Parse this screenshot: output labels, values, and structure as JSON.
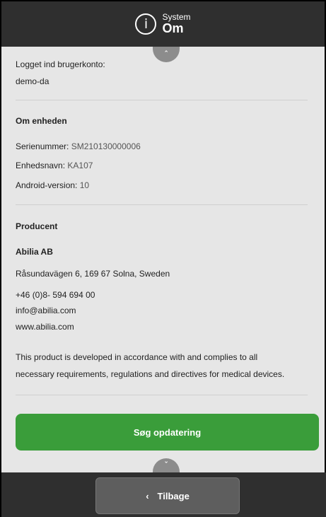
{
  "header": {
    "sup": "System",
    "title": "Om"
  },
  "account": {
    "label": "Logget ind brugerkonto:",
    "value": "demo-da"
  },
  "device": {
    "heading": "Om enheden",
    "serial_label": "Serienummer:",
    "serial_value": "SM210130000006",
    "name_label": "Enhedsnavn:",
    "name_value": "KA107",
    "android_label": "Android-version:",
    "android_value": "10"
  },
  "producer": {
    "heading": "Producent",
    "company": "Abilia AB",
    "address": "Råsundavägen 6, 169 67 Solna, Sweden",
    "phone": "+46 (0)8- 594 694 00",
    "email": "info@abilia.com",
    "web": "www.abilia.com",
    "compliance_line1": "This product is developed in accordance with and complies to all",
    "compliance_line2": "necessary requirements, regulations and directives for medical devices."
  },
  "actions": {
    "update_label": "Søg opdatering",
    "back_label": "Tilbage"
  },
  "icons": {
    "info": "info-circle-icon",
    "scroll_up": "chevron-up-icon",
    "scroll_down": "chevron-down-icon",
    "back": "chevron-left-icon"
  },
  "colors": {
    "topbar": "#2f2f2f",
    "content_bg": "#e6e6e6",
    "update_button": "#3a9d3a",
    "back_button": "#5e5e5e"
  }
}
